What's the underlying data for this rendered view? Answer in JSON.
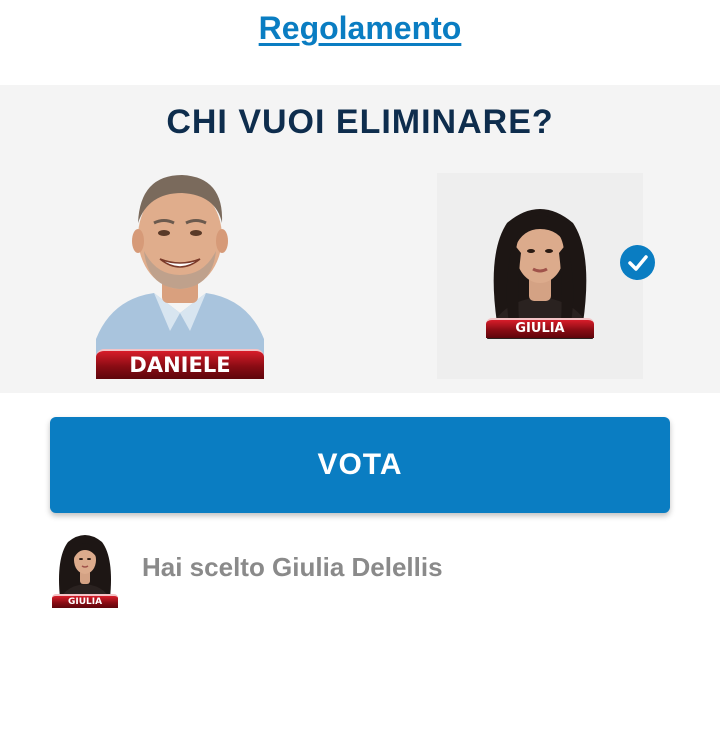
{
  "rules": {
    "link_label": "Regolamento"
  },
  "poll": {
    "question": "CHI VUOI ELIMINARE?",
    "candidates": [
      {
        "name_plate": "DANIELE",
        "selected": false
      },
      {
        "name_plate": "GIULIA",
        "selected": true
      }
    ]
  },
  "vote": {
    "button_label": "VOTA"
  },
  "choice": {
    "text": "Hai scelto Giulia Delellis",
    "thumb_plate": "GIULIA"
  },
  "colors": {
    "accent": "#0a7dc2",
    "title": "#0e2d4d",
    "plate_red": "#8a0c14",
    "panel_bg": "#f4f4f4",
    "muted_text": "#8a8a8a"
  },
  "icons": {
    "selected": "check-icon"
  }
}
